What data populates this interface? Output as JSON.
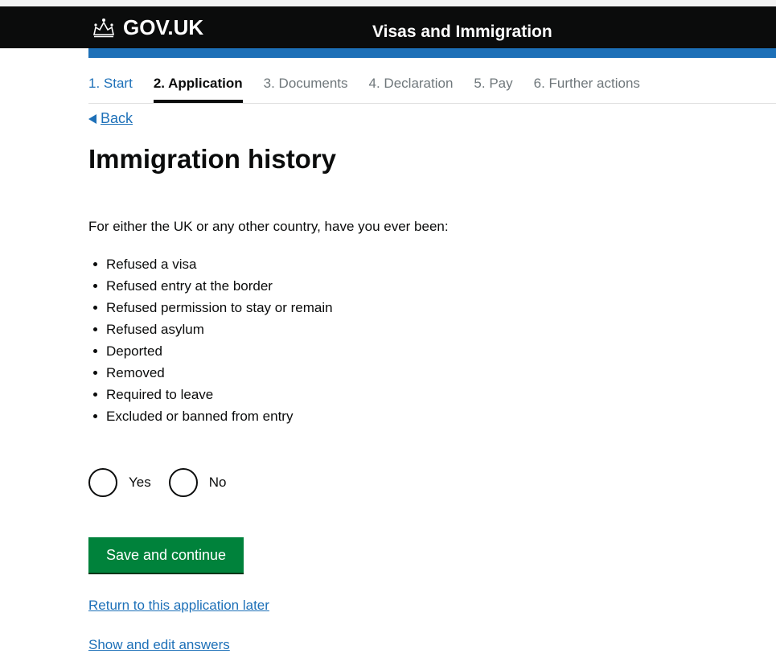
{
  "header": {
    "logo_text": "GOV.UK",
    "logo_icon": "crown-icon",
    "service_name": "Visas and Immigration"
  },
  "steps": [
    {
      "label": "1. Start",
      "state": "done"
    },
    {
      "label": "2. Application",
      "state": "current"
    },
    {
      "label": "3. Documents",
      "state": "upcoming"
    },
    {
      "label": "4. Declaration",
      "state": "upcoming"
    },
    {
      "label": "5. Pay",
      "state": "upcoming"
    },
    {
      "label": "6. Further actions",
      "state": "upcoming"
    }
  ],
  "back_label": "Back",
  "page_title": "Immigration history",
  "question_intro": "For either the UK or any other country, have you ever been:",
  "reasons": [
    "Refused a visa",
    "Refused entry at the border",
    "Refused permission to stay or remain",
    "Refused asylum",
    "Deported",
    "Removed",
    "Required to leave",
    "Excluded or banned from entry"
  ],
  "options": {
    "yes_label": "Yes",
    "no_label": "No"
  },
  "save_label": "Save and continue",
  "return_later_label": "Return to this application later",
  "show_answers_label": "Show and edit answers",
  "colors": {
    "header_bg": "#0b0c0c",
    "accent_blue": "#1d70b8",
    "button_green": "#00823b"
  }
}
